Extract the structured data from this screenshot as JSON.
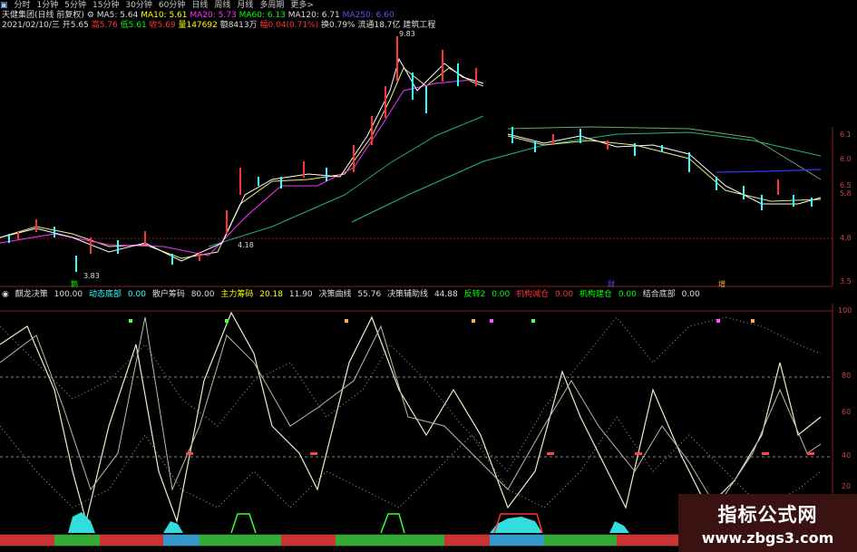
{
  "toolbar": {
    "items": [
      "分时",
      "1分钟",
      "5分钟",
      "15分钟",
      "30分钟",
      "60分钟",
      "日线",
      "周线",
      "月线",
      "多周期",
      "更多>"
    ]
  },
  "info": {
    "stock_name": "天健集团(日线 前复权)",
    "ma5": "MA5: 5.64",
    "ma10": "MA10: 5.61",
    "ma20": "MA20: 5.73",
    "ma60": "MA60: 6.13",
    "ma120": "MA120: 6.71",
    "ma250": "MA250: 6.60",
    "date": "2021/02/10/三",
    "open": "开5.65",
    "high": "高5.76",
    "low": "低5.61",
    "close": "收5.69",
    "volume": "量147692",
    "amount": "额8413万",
    "change": "幅0.04(0.71%)",
    "turnover": "换0.79%",
    "float_cap": "流通18.7亿",
    "sector": "建筑工程"
  },
  "price_annotations": {
    "high_label": "9.83",
    "low_label": "3.83",
    "mid_label": "4.18"
  },
  "right_axis_top": [
    "6.1",
    "6.0",
    "6.5",
    "5.8",
    "4.8",
    "3.5"
  ],
  "right_axis_bottom": [
    "100",
    "80",
    "60",
    "40",
    "20"
  ],
  "event_markers": {
    "left": "鹅",
    "mid": "财",
    "right": "增"
  },
  "indicator": {
    "name": "麒龙决策",
    "v1": "100.00",
    "dyn_low_label": "动态底部",
    "dyn_low_val": "0.00",
    "scatter_label": "散户筹码",
    "scatter_val": "80.00",
    "main_label": "主力筹码",
    "main_val": "20.18",
    "v2": "11.90",
    "decision_label": "决策曲线",
    "decision_val": "55.76",
    "aux_label": "决策辅助线",
    "aux_val": "44.88",
    "reversal_label": "反转2",
    "reversal_val": "0.00",
    "inst_reduce_label": "机构减仓",
    "inst_reduce_val": "0.00",
    "inst_add_label": "机构建仓",
    "inst_add_val": "0.00",
    "combo_low_label": "结合底部",
    "combo_low_val": "0.00"
  },
  "watermark": {
    "line1": "指标公式网",
    "line2": "www.zbgs3.com"
  },
  "colors": {
    "up": "#ff3333",
    "down": "#33ffff",
    "ma5": "#ffffff",
    "ma10": "#ffff00",
    "ma20": "#ff33ff",
    "ma60": "#00ff00",
    "accent_bg": "#3a1212"
  }
}
